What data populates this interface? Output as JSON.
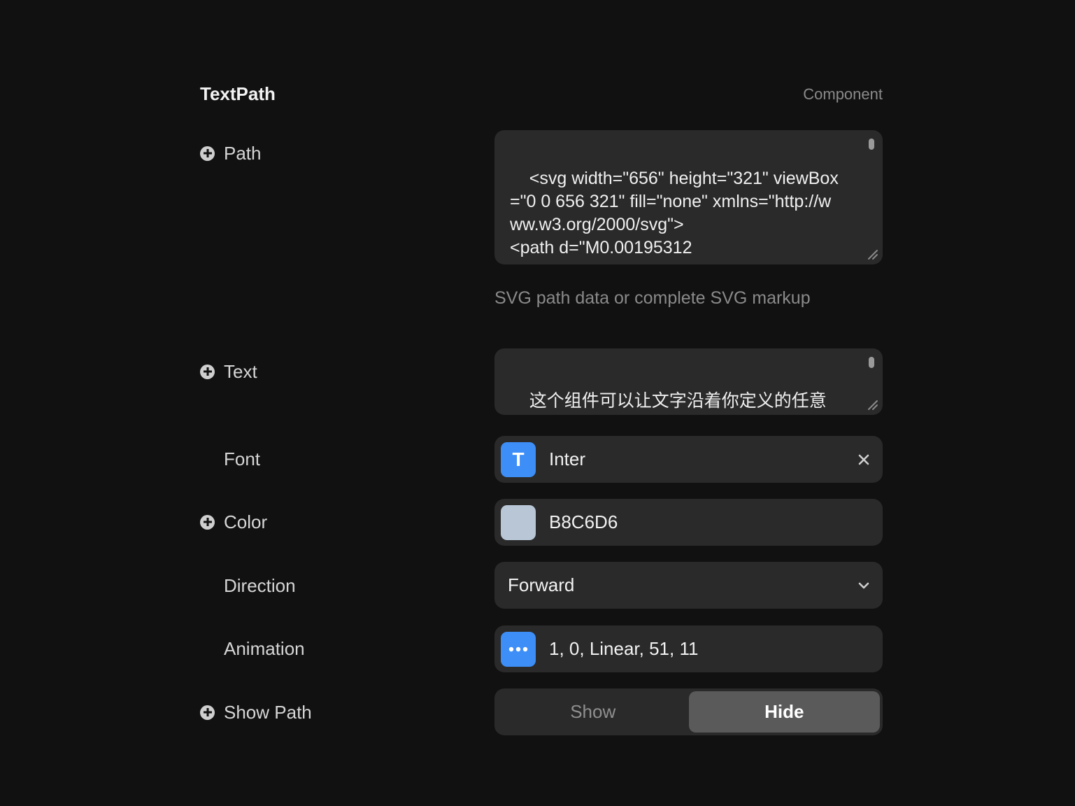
{
  "header": {
    "title": "TextPath",
    "kind": "Component"
  },
  "colors": {
    "background": "#111111",
    "control": "#2a2a2a",
    "accent": "#3d8ef7",
    "color_value": "#B8C6D6"
  },
  "path": {
    "label": "Path",
    "value": "<svg width=\"656\" height=\"321\" viewBox=\"0 0 656 321\" fill=\"none\" xmlns=\"http://www.w3.org/2000/svg\">\n<path d=\"M0.00195312",
    "hint": "SVG path data or complete SVG markup"
  },
  "text": {
    "label": "Text",
    "value": "这个组件可以让文字沿着你定义的任意路径平滑移动。你可以控制移动速度，"
  },
  "font": {
    "label": "Font",
    "icon": "type-icon",
    "icon_glyph": "T",
    "value": "Inter"
  },
  "color": {
    "label": "Color",
    "value": "B8C6D6"
  },
  "direction": {
    "label": "Direction",
    "value": "Forward"
  },
  "animation": {
    "label": "Animation",
    "icon": "more-icon",
    "value": "1, 0, Linear, 51, 11"
  },
  "show_path": {
    "label": "Show Path",
    "options": [
      "Show",
      "Hide"
    ],
    "selected": "Hide"
  }
}
